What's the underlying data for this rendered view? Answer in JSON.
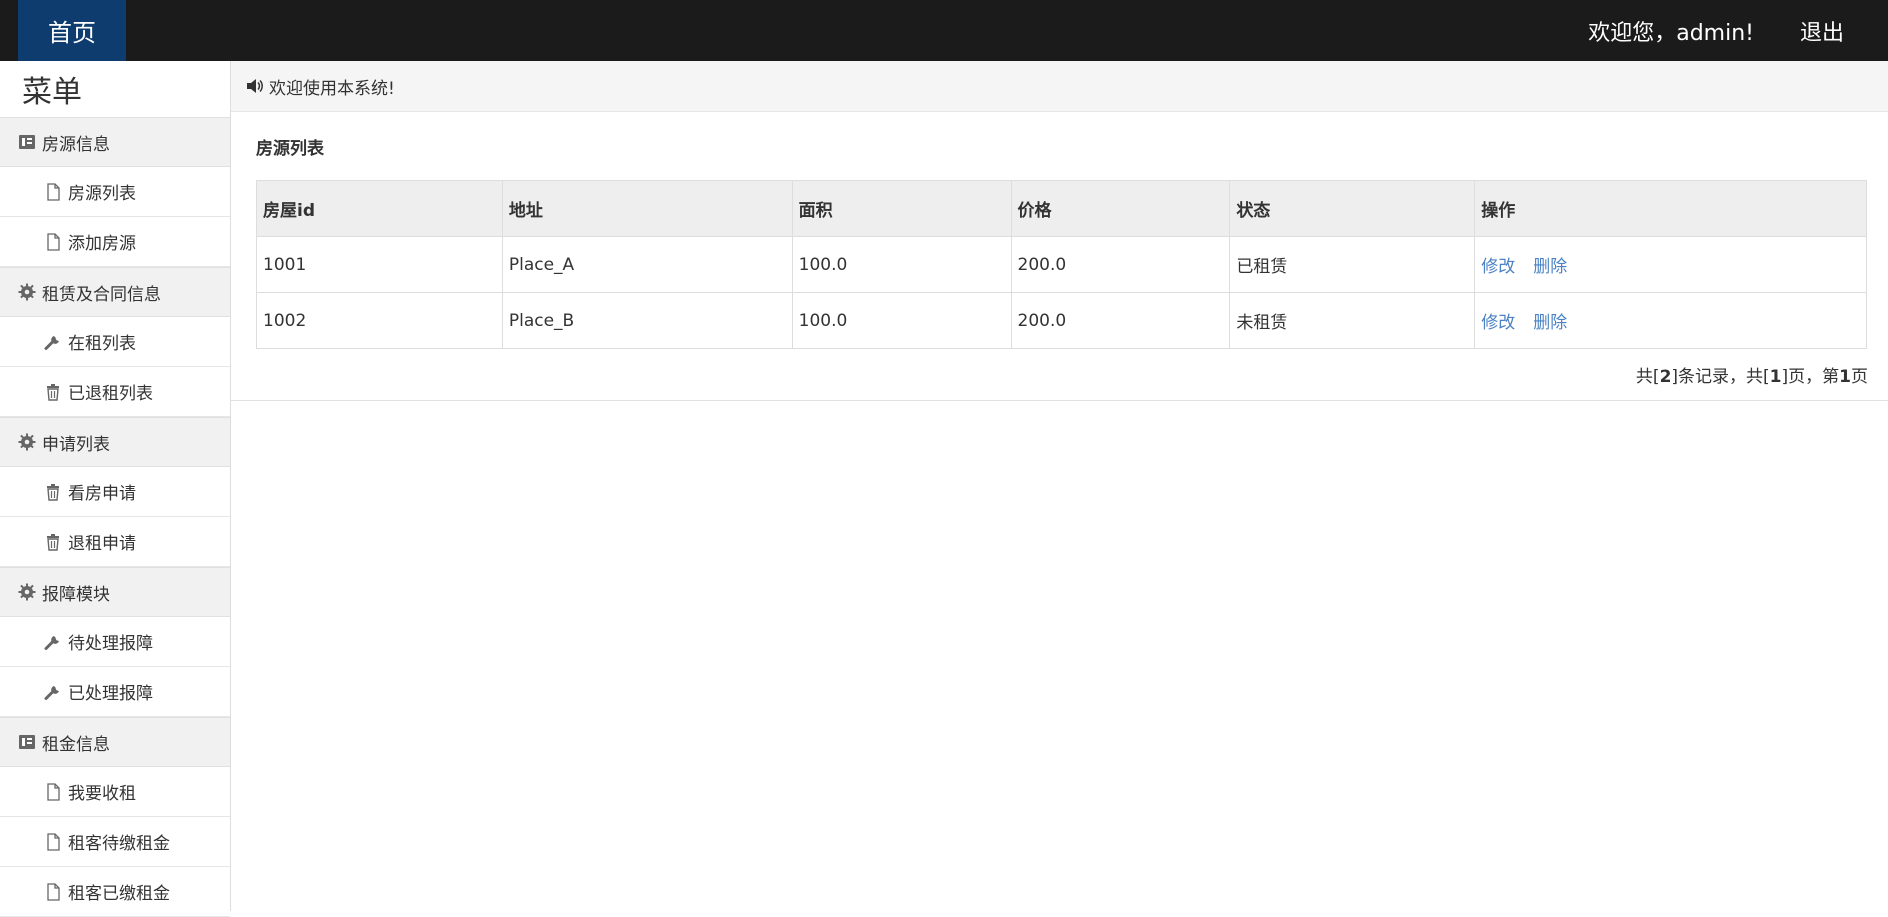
{
  "navbar": {
    "brand": "首页",
    "welcome": "欢迎您，admin!",
    "logout": "退出"
  },
  "sidebar": {
    "title": "菜单",
    "groups": [
      {
        "label": "房源信息",
        "icon": "book-icon",
        "items": [
          {
            "label": "房源列表",
            "icon": "file-icon"
          },
          {
            "label": "添加房源",
            "icon": "file-icon"
          }
        ]
      },
      {
        "label": "租赁及合同信息",
        "icon": "gear-icon",
        "items": [
          {
            "label": "在租列表",
            "icon": "wrench-icon"
          },
          {
            "label": "已退租列表",
            "icon": "trash-icon"
          }
        ]
      },
      {
        "label": "申请列表",
        "icon": "gear-icon",
        "items": [
          {
            "label": "看房申请",
            "icon": "trash-icon"
          },
          {
            "label": "退租申请",
            "icon": "trash-icon"
          }
        ]
      },
      {
        "label": "报障模块",
        "icon": "gear-icon",
        "items": [
          {
            "label": "待处理报障",
            "icon": "wrench-icon"
          },
          {
            "label": "已处理报障",
            "icon": "wrench-icon"
          }
        ]
      },
      {
        "label": "租金信息",
        "icon": "book-icon",
        "items": [
          {
            "label": "我要收租",
            "icon": "file-icon"
          },
          {
            "label": "租客待缴租金",
            "icon": "file-icon"
          },
          {
            "label": "租客已缴租金",
            "icon": "file-icon"
          }
        ]
      }
    ]
  },
  "notice": {
    "text": "欢迎使用本系统!",
    "icon": "volume-icon"
  },
  "panel": {
    "title": "房源列表",
    "columns": [
      "房屋id",
      "地址",
      "面积",
      "价格",
      "状态",
      "操作"
    ],
    "rows": [
      {
        "id": "1001",
        "address": "Place_A",
        "area": "100.0",
        "price": "200.0",
        "status": "已租赁",
        "edit": "修改",
        "delete": "删除"
      },
      {
        "id": "1002",
        "address": "Place_B",
        "area": "100.0",
        "price": "200.0",
        "status": "未租赁",
        "edit": "修改",
        "delete": "删除"
      }
    ],
    "pager": {
      "prefix": "共[",
      "total": "2",
      "mid1": "]条记录，共[",
      "pages": "1",
      "mid2": "]页，第",
      "current": "1",
      "suffix": "页"
    }
  },
  "colors": {
    "navbar_bg": "#1b1b1b",
    "brand_bg": "#0f3c6f",
    "link": "#4a82c3"
  }
}
